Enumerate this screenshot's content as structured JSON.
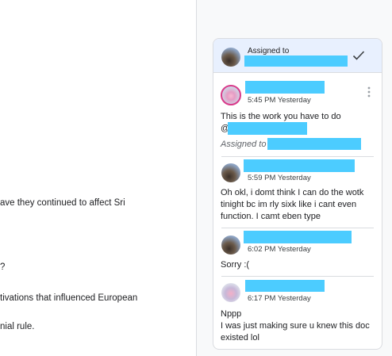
{
  "document": {
    "lines": [
      "ave they continued to affect Sri",
      "?",
      "tivations that influenced European",
      "nial rule."
    ]
  },
  "comment_thread": {
    "assigned_header": {
      "label": "Assigned to",
      "icon": "check-icon"
    },
    "comments": [
      {
        "time": "5:45 PM Yesterday",
        "text_lines": [
          "This is the work you have to do",
          "@"
        ],
        "assigned_label": "Assigned to",
        "avatar": "pink-avatar",
        "more_icon": "more-vert-icon"
      },
      {
        "time": "5:59 PM Yesterday",
        "text_lines": [
          "Oh okl, i domt think I can do the wotk",
          "tinight bc im rly sixk like i cant even",
          "function. I camt eben type"
        ],
        "avatar": "dark-avatar"
      },
      {
        "time": "6:02 PM Yesterday",
        "text_lines": [
          "Sorry :("
        ],
        "avatar": "dark-avatar"
      },
      {
        "time": "6:17 PM Yesterday",
        "text_lines": [
          "Nppp",
          "I was just making sure u knew this doc",
          "existed lol"
        ],
        "avatar": "soft-avatar"
      }
    ]
  },
  "colors": {
    "redaction": "#4cccff",
    "header_bg": "#e8f0fe",
    "pink_ring": "#d93a8a"
  }
}
